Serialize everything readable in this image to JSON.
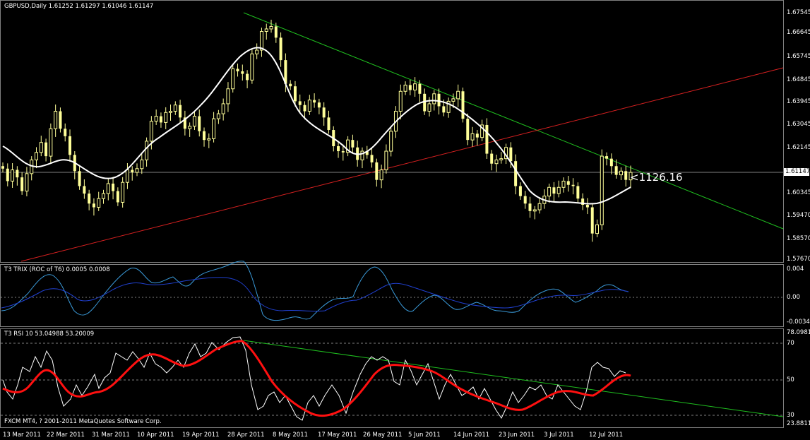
{
  "window": {
    "symbol_title": "GBPUSD,Daily  1.61252 1.61297 1.61046 1.61147",
    "copyright": "FXCM MT4, ? 2001-2011 MetaQuotes Software Corp.",
    "cursor_readout": "<1126.16"
  },
  "price_axis": {
    "labels": [
      "1.67545",
      "1.66645",
      "1.65745",
      "1.64845",
      "1.63945",
      "1.63045",
      "1.62145",
      "1.60345",
      "1.59470",
      "1.58570",
      "1.57670"
    ],
    "current_price_label": "1.61147",
    "current_price": 1.61147
  },
  "trix_pane": {
    "title": "T3 TRIX (ROC of T6) 0.0005 0.0008",
    "axis_labels": [
      "0.004",
      "0.00",
      "-0.0034"
    ]
  },
  "rsi_pane": {
    "title": "T3 RSI 10 53.04988 53.20009",
    "axis_labels": [
      "78.0981",
      "70",
      "50",
      "30",
      "23.8811"
    ]
  },
  "time_axis": {
    "labels": [
      "13 Mar 2011",
      "22 Mar 2011",
      "31 Mar 2011",
      "10 Apr 2011",
      "19 Apr 2011",
      "28 Apr 2011",
      "8 May 2011",
      "17 May 2011",
      "26 May 2011",
      "5 Jun 2011",
      "14 Jun 2011",
      "23 Jun 2011",
      "3 Jul 2011",
      "12 Jul 2011"
    ]
  },
  "colors": {
    "background": "#000000",
    "candle": "#ffff99",
    "ma_line": "#ffffff",
    "downtrend_line": "#1fbf1f",
    "uptrend_line": "#d62020",
    "trix_fast": "#3a9ad9",
    "trix_slow": "#2040d0",
    "rsi_raw": "#ffffff",
    "rsi_smooth": "#ff1010",
    "grid": "#808080"
  },
  "chart_data": {
    "type": "line",
    "symbol": "GBPUSD",
    "timeframe": "Daily",
    "last_close": 1.61147,
    "bar_closes": [
      1.613,
      1.608,
      1.6125,
      1.6095,
      1.604,
      1.611,
      1.6165,
      1.6195,
      1.6235,
      1.618,
      1.629,
      1.636,
      1.629,
      1.626,
      1.6185,
      1.612,
      1.606,
      1.603,
      1.599,
      1.5975,
      1.601,
      1.603,
      1.607,
      1.604,
      1.5995,
      1.6075,
      1.6125,
      1.6115,
      1.613,
      1.6165,
      1.624,
      1.632,
      1.634,
      1.6315,
      1.6355,
      1.636,
      1.6385,
      1.6335,
      1.629,
      1.63,
      1.634,
      1.628,
      1.6245,
      1.625,
      1.633,
      1.635,
      1.639,
      1.645,
      1.653,
      1.652,
      1.651,
      1.6485,
      1.659,
      1.6605,
      1.668,
      1.669,
      1.67,
      1.6655,
      1.6565,
      1.647,
      1.646,
      1.64,
      1.6385,
      1.636,
      1.6405,
      1.6395,
      1.6375,
      1.6335,
      1.6285,
      1.622,
      1.62,
      1.6195,
      1.6245,
      1.6215,
      1.6165,
      1.62,
      1.6185,
      1.6155,
      1.6085,
      1.6125,
      1.62,
      1.628,
      1.636,
      1.644,
      1.6465,
      1.6445,
      1.647,
      1.643,
      1.636,
      1.639,
      1.643,
      1.638,
      1.6355,
      1.64,
      1.641,
      1.644,
      1.633,
      1.6245,
      1.627,
      1.6255,
      1.6305,
      1.619,
      1.615,
      1.6165,
      1.617,
      1.6215,
      1.616,
      1.606,
      1.602,
      1.599,
      1.596,
      1.5965,
      1.599,
      1.602,
      1.6055,
      1.603,
      1.6055,
      1.608,
      1.6065,
      1.606,
      1.601,
      1.5985,
      1.5975,
      1.587,
      1.5905,
      1.618,
      1.617,
      1.614,
      1.6105,
      1.612,
      1.6085,
      1.6115
    ]
  }
}
